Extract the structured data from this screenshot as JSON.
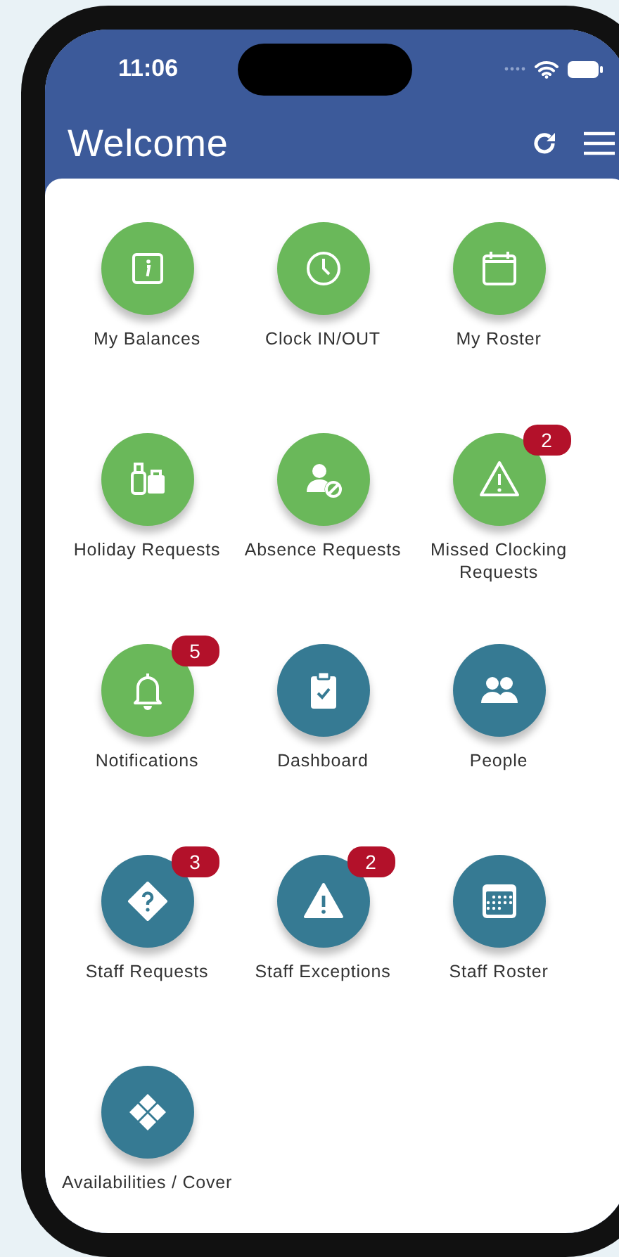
{
  "status_bar": {
    "time": "11:06"
  },
  "header": {
    "title": "Welcome"
  },
  "tiles": [
    {
      "label": "My Balances",
      "kind": "info",
      "color": "#6ab85a"
    },
    {
      "label": "Clock IN/OUT",
      "kind": "clock",
      "color": "#6ab85a"
    },
    {
      "label": "My Roster",
      "kind": "calendar",
      "color": "#6ab85a"
    },
    {
      "label": "Holiday Requests",
      "kind": "luggage",
      "color": "#6ab85a"
    },
    {
      "label": "Absence Requests",
      "kind": "person-block",
      "color": "#6ab85a"
    },
    {
      "label": "Missed Clocking Requests",
      "kind": "warning-outline",
      "color": "#6ab85a",
      "badge": "2"
    },
    {
      "label": "Notifications",
      "kind": "bell",
      "color": "#6ab85a",
      "badge": "5"
    },
    {
      "label": "Dashboard",
      "kind": "clipboard",
      "color": "#367a93"
    },
    {
      "label": "People",
      "kind": "people",
      "color": "#367a93"
    },
    {
      "label": "Staff Requests",
      "kind": "question-diamond",
      "color": "#367a93",
      "badge": "3"
    },
    {
      "label": "Staff Exceptions",
      "kind": "warning-filled",
      "color": "#367a93",
      "badge": "2"
    },
    {
      "label": "Staff Roster",
      "kind": "calendar-grid",
      "color": "#367a93"
    },
    {
      "label": "Availabilities / Cover",
      "kind": "diamonds",
      "color": "#367a93"
    }
  ]
}
